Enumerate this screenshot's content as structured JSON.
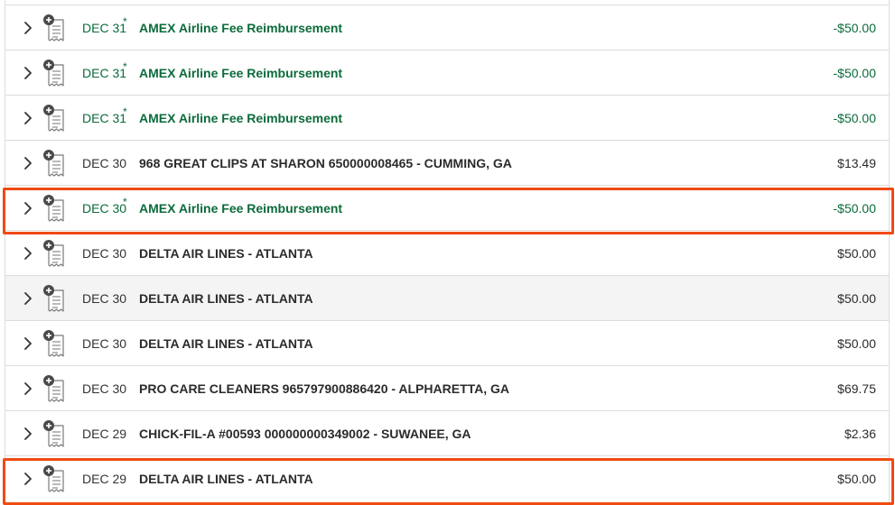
{
  "highlight_color": "#f04a12",
  "credit_color": "#0b6b3a",
  "transactions": [
    {
      "date": "DEC 31",
      "pending_mark": "*",
      "description": "AMEX Airline Fee Reimbursement",
      "amount": "-$50.00",
      "credit": true
    },
    {
      "date": "DEC 31",
      "pending_mark": "*",
      "description": "AMEX Airline Fee Reimbursement",
      "amount": "-$50.00",
      "credit": true
    },
    {
      "date": "DEC 31",
      "pending_mark": "*",
      "description": "AMEX Airline Fee Reimbursement",
      "amount": "-$50.00",
      "credit": true
    },
    {
      "date": "DEC 30",
      "pending_mark": "",
      "description": "968 GREAT CLIPS AT SHARON 650000008465 - CUMMING, GA",
      "amount": "$13.49",
      "credit": false
    },
    {
      "date": "DEC 30",
      "pending_mark": "*",
      "description": "AMEX Airline Fee Reimbursement",
      "amount": "-$50.00",
      "credit": true,
      "highlighted": true
    },
    {
      "date": "DEC 30",
      "pending_mark": "",
      "description": "DELTA AIR LINES - ATLANTA",
      "amount": "$50.00",
      "credit": false
    },
    {
      "date": "DEC 30",
      "pending_mark": "",
      "description": "DELTA AIR LINES - ATLANTA",
      "amount": "$50.00",
      "credit": false,
      "hovered": true
    },
    {
      "date": "DEC 30",
      "pending_mark": "",
      "description": "DELTA AIR LINES - ATLANTA",
      "amount": "$50.00",
      "credit": false
    },
    {
      "date": "DEC 30",
      "pending_mark": "",
      "description": "PRO CARE CLEANERS 965797900886420 - ALPHARETTA, GA",
      "amount": "$69.75",
      "credit": false
    },
    {
      "date": "DEC 29",
      "pending_mark": "",
      "description": "CHICK-FIL-A #00593 000000000349002 - SUWANEE, GA",
      "amount": "$2.36",
      "credit": false
    },
    {
      "date": "DEC 29",
      "pending_mark": "",
      "description": "DELTA AIR LINES - ATLANTA",
      "amount": "$50.00",
      "credit": false,
      "highlighted": true
    }
  ],
  "icons": {
    "expand": "chevron-right-icon",
    "receipt": "add-receipt-icon"
  }
}
